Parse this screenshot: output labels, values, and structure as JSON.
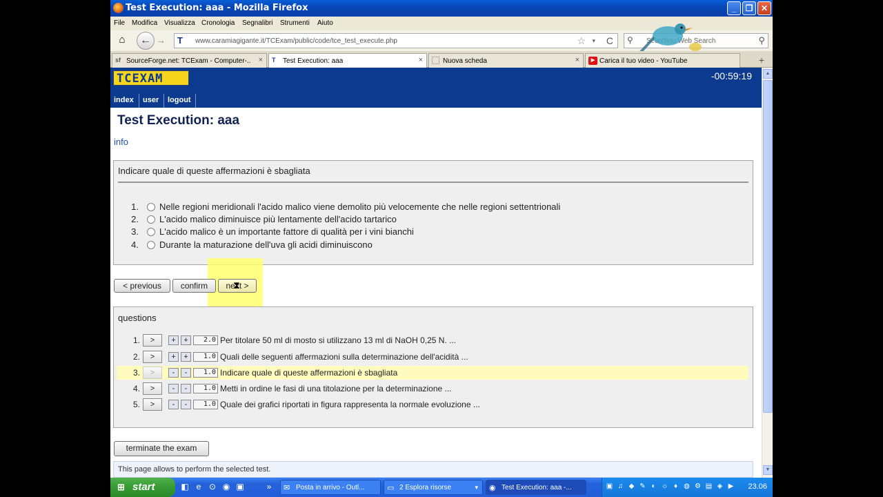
{
  "window": {
    "title": "Test Execution: aaa - Mozilla Firefox",
    "minimize_icon": "_",
    "maximize_icon": "❐",
    "close_icon": "✕"
  },
  "menu": [
    "File",
    "Modifica",
    "Visualizza",
    "Cronologia",
    "Segnalibri",
    "Strumenti",
    "Aiuto"
  ],
  "navbar": {
    "url": "www.caramiagigante.it/TCExam/public/code/tce_test_execute.php",
    "search_placeholder": "Searchqu Web Search",
    "site_icon": "T",
    "home_icon": "⌂",
    "back_icon": "←",
    "forward_icon": "→",
    "star_icon": "☆",
    "dropdown_icon": "▾",
    "reload_icon": "C",
    "search_icon": "⚲"
  },
  "tabs": [
    {
      "icon": "sf",
      "label": "SourceForge.net: TCExam - Computer-..."
    },
    {
      "icon": "T",
      "label": "Test Execution: aaa"
    },
    {
      "icon": "",
      "label": "Nuova scheda"
    },
    {
      "icon": "▶",
      "label": "Carica il tuo video - YouTube"
    }
  ],
  "tab_close_icon": "×",
  "new_tab_icon": "+",
  "scroll": {
    "up": "▲",
    "down": "▼"
  },
  "app": {
    "logo": "TCEXAM",
    "timer": "-00:59:19",
    "nav": [
      "index",
      "user",
      "logout"
    ],
    "page_title": "Test Execution: aaa",
    "info_link": "info"
  },
  "question": {
    "text": "Indicare quale di queste affermazioni è sbagliata",
    "answers": [
      {
        "num": "1.",
        "text": "Nelle regioni meridionali l'acido malico viene demolito più velocemente che nelle regioni settentrionali"
      },
      {
        "num": "2.",
        "text": "L'acido malico diminuisce più lentamente dell'acido tartarico"
      },
      {
        "num": "3.",
        "text": "L'acido malico è un importante fattore di qualità per i vini bianchi"
      },
      {
        "num": "4.",
        "text": "Durante la maturazione dell'uva gli acidi diminuiscono"
      }
    ]
  },
  "buttons": {
    "previous": "< previous",
    "confirm": "confirm",
    "next": "next >",
    "terminate": "terminate the exam"
  },
  "questions_panel": {
    "title": "questions",
    "rows": [
      {
        "num": "1.",
        "go": ">",
        "a": "+",
        "b": "+",
        "score": "2.0",
        "text": "Per titolare 50 ml di mosto si utilizzano 13 ml di NaOH 0,25 N. ..."
      },
      {
        "num": "2.",
        "go": ">",
        "a": "+",
        "b": "+",
        "score": "1.0",
        "text": "Quali delle seguenti affermazioni sulla determinazione dell'acidità ..."
      },
      {
        "num": "3.",
        "go": ">",
        "a": "-",
        "b": "-",
        "score": "1.0",
        "text": "Indicare quale di queste affermazioni è sbagliata"
      },
      {
        "num": "4.",
        "go": ">",
        "a": "-",
        "b": "-",
        "score": "1.0",
        "text": "Metti in ordine le fasi di una titolazione per la determinazione ..."
      },
      {
        "num": "5.",
        "go": ">",
        "a": "-",
        "b": "-",
        "score": "1.0",
        "text": "Quale dei grafici riportati in figura rappresenta la normale evoluzione ..."
      }
    ]
  },
  "footer": "This page allows to perform the selected test.",
  "taskbar": {
    "start": "start",
    "start_icon": "⊞",
    "quicklaunch": [
      "◧",
      "e",
      "⊙",
      "◉",
      "▣"
    ],
    "items": [
      {
        "icon": "✉",
        "label": "Posta in arrivo - Outl..."
      },
      {
        "icon": "▭",
        "label": "2 Esplora risorse"
      },
      {
        "icon": "◉",
        "label": "Test Execution: aaa -..."
      }
    ],
    "tray_icons": [
      "▣",
      "♫",
      "◆",
      "✎",
      "◐",
      "☼",
      "♦",
      "◍",
      "⚙",
      "▤",
      "◈",
      "▶"
    ],
    "clock": "23.06"
  }
}
